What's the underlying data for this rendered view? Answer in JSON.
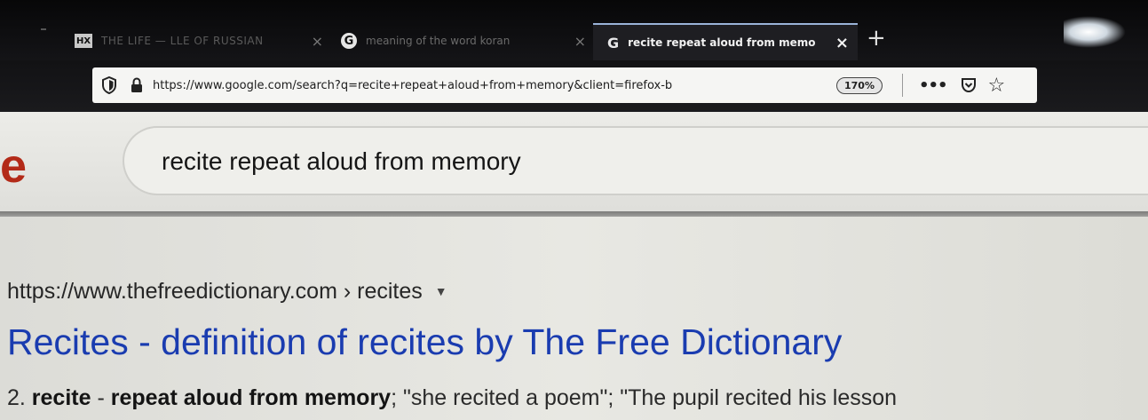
{
  "tabs": [
    {
      "favicon": "HX",
      "favicon_icon": "hx-favicon-icon",
      "label": "THE LIFE — LLE OF RUSSIAN",
      "active": false
    },
    {
      "favicon": "G",
      "favicon_icon": "google-favicon-icon",
      "label": "meaning of the word koran",
      "active": false
    },
    {
      "favicon": "G",
      "favicon_icon": "google-favicon-icon",
      "label": "recite repeat aloud from memo",
      "active": true
    }
  ],
  "tab_close_icon": "×",
  "new_tab_icon": "+",
  "toolbar": {
    "url": "https://www.google.com/search?q=recite+repeat+aloud+from+memory&client=firefox-b",
    "zoom": "170%",
    "more_icon": "•••",
    "star_icon": "☆"
  },
  "search": {
    "logo_fragment": "e",
    "query": "recite repeat aloud from memory"
  },
  "result": {
    "cite": "https://www.thefreedictionary.com › recites",
    "caret": "▼",
    "title": "Recites - definition of recites by The Free Dictionary",
    "snippet_prefix": "2. ",
    "snippet_bold_1": "recite",
    "snippet_mid": " - ",
    "snippet_bold_2": "repeat aloud from memory",
    "snippet_rest": "; \"she recited a poem\"; \"The pupil recited his lesson"
  },
  "colors": {
    "tab_bar": "#0b0b0d",
    "url_bar": "#f5f5f3",
    "logo_red": "#b32a18",
    "link_blue": "#1a3cb0"
  }
}
